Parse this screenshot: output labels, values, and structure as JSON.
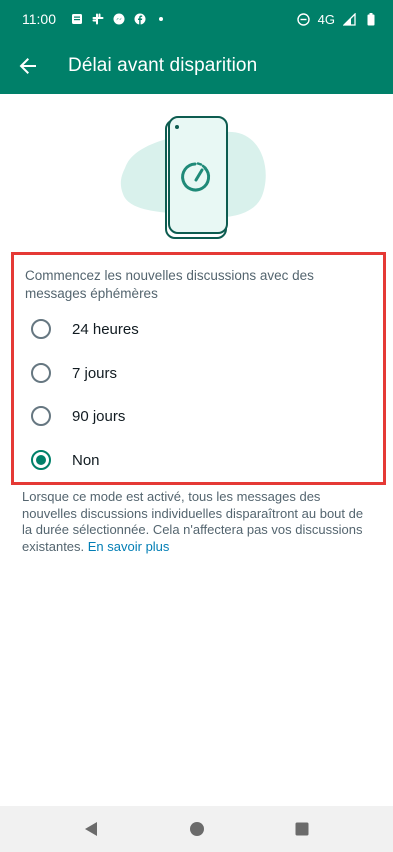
{
  "status_bar": {
    "time": "11:00",
    "network": "4G",
    "icons": [
      "message-icon",
      "slack-icon",
      "messenger-icon",
      "facebook-icon",
      "dot-icon",
      "dnd-icon",
      "signal-icon",
      "battery-icon"
    ]
  },
  "app_bar": {
    "title": "Délai avant disparition",
    "back_icon": "arrow-back-icon"
  },
  "illustration": {
    "icon": "phone-timer-illustration"
  },
  "options": {
    "title": "Commencez les nouvelles discussions avec des messages éphémères",
    "items": [
      {
        "label": "24 heures",
        "checked": false
      },
      {
        "label": "7 jours",
        "checked": false
      },
      {
        "label": "90 jours",
        "checked": false
      },
      {
        "label": "Non",
        "checked": true
      }
    ]
  },
  "info": {
    "text": "Lorsque ce mode est activé, tous les messages des nouvelles discussions individuelles disparaîtront au bout de la durée sélectionnée. Cela n'affectera pas vos discussions existantes.",
    "link": "En savoir plus"
  },
  "colors": {
    "primary": "#008069",
    "highlight_border": "#e53935",
    "link": "#027eb5"
  }
}
